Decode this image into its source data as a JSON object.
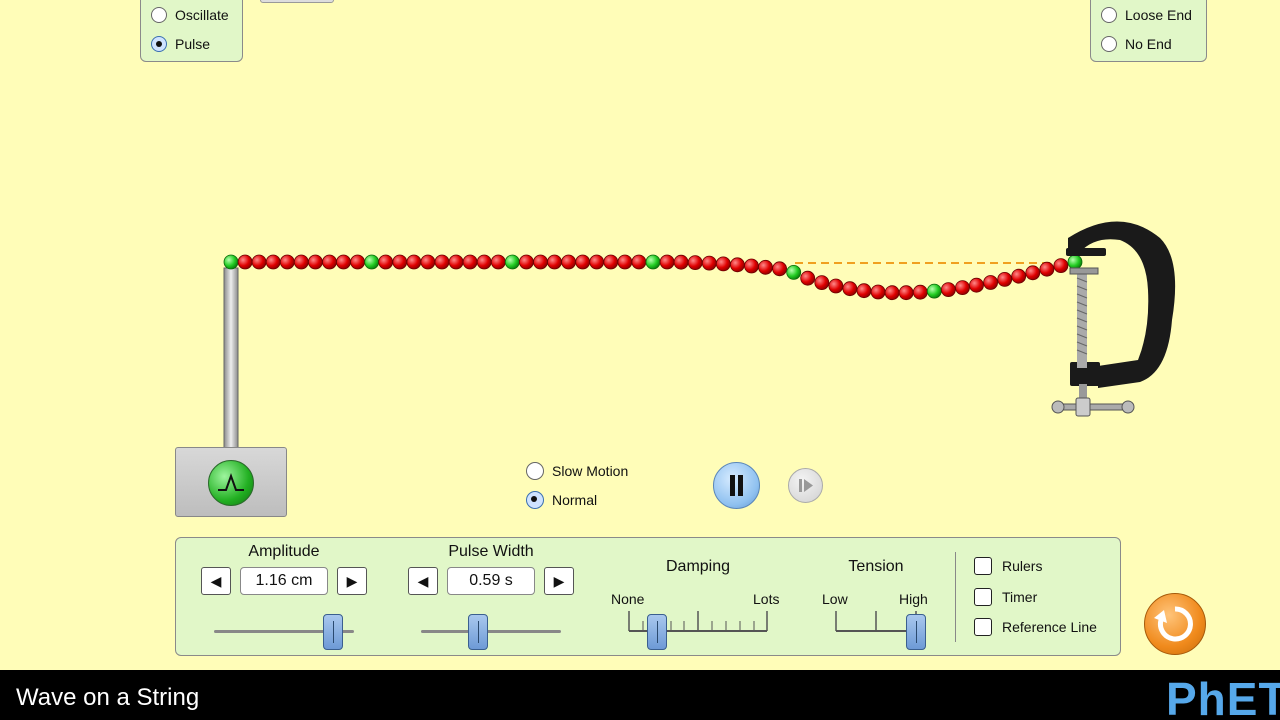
{
  "wave_mode": {
    "options": [
      {
        "label": "Oscillate",
        "selected": false
      },
      {
        "label": "Pulse",
        "selected": true
      }
    ]
  },
  "end_mode": {
    "options": [
      {
        "label": "Loose End",
        "selected": false
      },
      {
        "label": "No End",
        "selected": false
      }
    ]
  },
  "time_speed": {
    "options": [
      {
        "label": "Slow Motion",
        "selected": false
      },
      {
        "label": "Normal",
        "selected": true
      }
    ]
  },
  "controls": {
    "amplitude": {
      "label": "Amplitude",
      "value": "1.16 cm",
      "fraction": 0.92
    },
    "pulse_width": {
      "label": "Pulse Width",
      "value": "0.59 s",
      "fraction": 0.48
    },
    "damping": {
      "label": "Damping",
      "min_label": "None",
      "max_label": "Lots",
      "fraction": 0.2
    },
    "tension": {
      "label": "Tension",
      "min_label": "Low",
      "max_label": "High",
      "fraction": 1.0
    }
  },
  "checkboxes": [
    {
      "label": "Rulers",
      "checked": false
    },
    {
      "label": "Timer",
      "checked": false
    },
    {
      "label": "Reference Line",
      "checked": false
    }
  ],
  "footer": {
    "title": "Wave on a String",
    "logo": "PhET"
  },
  "colors": {
    "background": "#FFFDB8",
    "panel": "#E1F7C8",
    "bead_red": "#E00000",
    "bead_green": "#22CC22",
    "reset_orange": "#F08A1C",
    "play_blue": "#8FC1F0"
  },
  "icons": {
    "pulse_button": "pulse-icon",
    "play_pause": "pause-icon",
    "step": "step-forward-icon",
    "reset": "reset-icon",
    "clamp": "clamp-icon"
  }
}
